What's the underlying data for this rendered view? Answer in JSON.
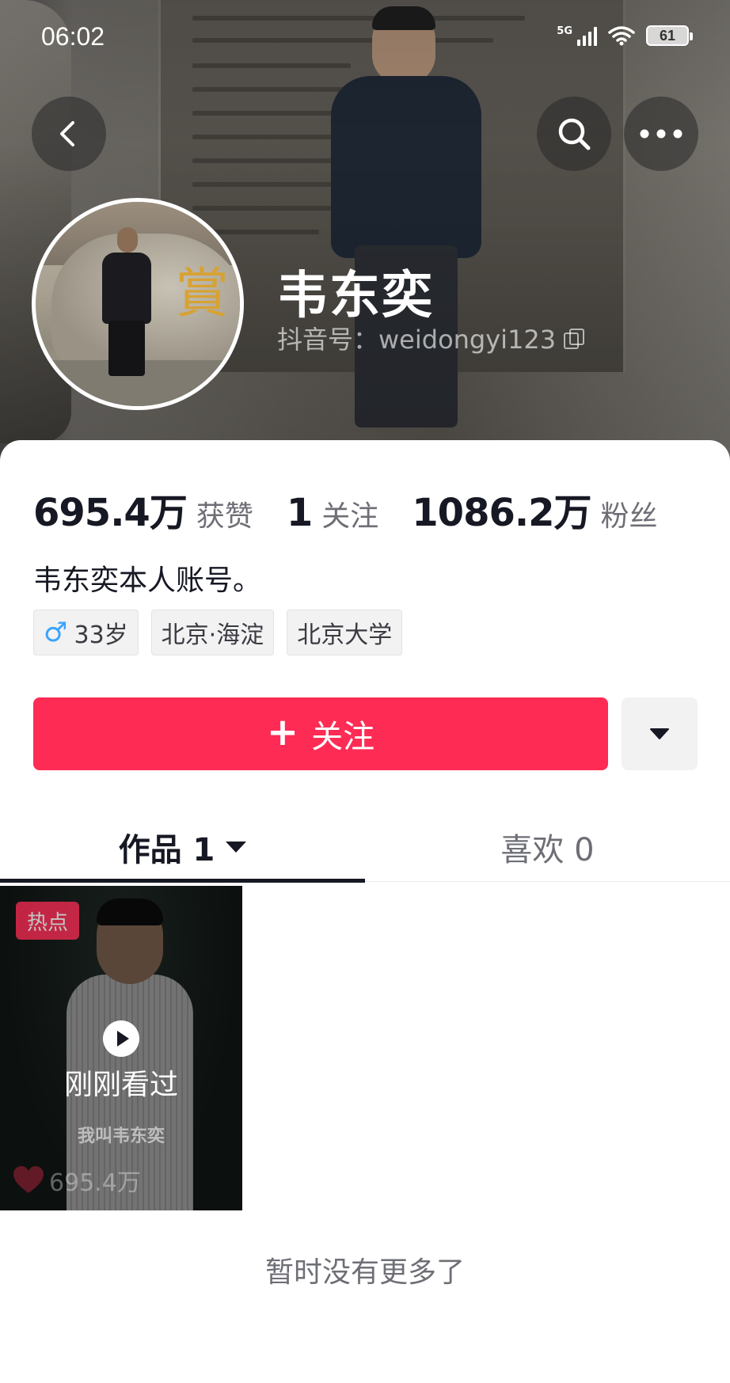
{
  "status_bar": {
    "time": "06:02",
    "network": "5G",
    "battery": "61"
  },
  "header": {
    "back_icon": "chevron-left-icon",
    "search_icon": "search-icon",
    "more_icon": "more-horizontal-icon"
  },
  "profile": {
    "name": "韦东奕",
    "douyin_id": "抖音号：weidongyi123",
    "stats": [
      {
        "value": "695.4万",
        "label": "获赞"
      },
      {
        "value": "1",
        "label": "关注"
      },
      {
        "value": "1086.2万",
        "label": "粉丝"
      }
    ],
    "bio": "韦东奕本人账号。",
    "tags": {
      "age": "33岁",
      "location": "北京·海淀",
      "school": "北京大学"
    }
  },
  "actions": {
    "follow_label": "关注",
    "follow_color": "#fe2c55"
  },
  "tabs": [
    {
      "label": "作品 1",
      "active": true
    },
    {
      "label": "喜欢 0",
      "active": false
    }
  ],
  "videos": [
    {
      "badge": "热点",
      "overlay_label": "刚刚看过",
      "caption": "我叫韦东奕",
      "likes": "695.4万"
    }
  ],
  "footer": {
    "no_more": "暂时没有更多了"
  }
}
